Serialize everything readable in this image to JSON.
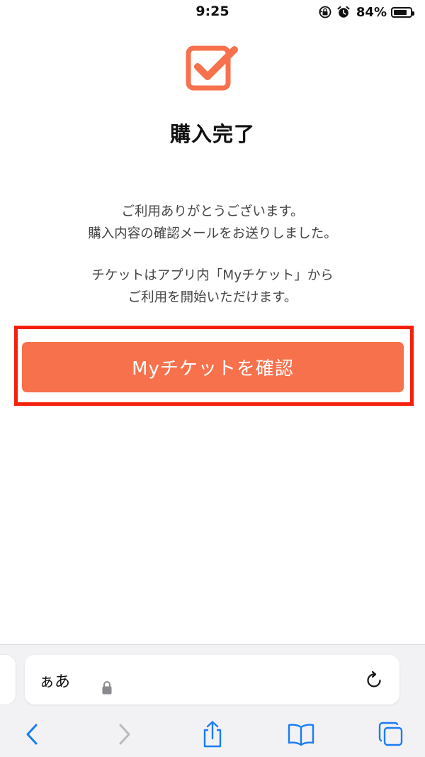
{
  "status_bar": {
    "time": "9:25",
    "battery_percent": "84%",
    "battery_level": 0.84,
    "icons": [
      "orientation-lock-icon",
      "alarm-icon",
      "battery-icon"
    ]
  },
  "page": {
    "title": "購入完了",
    "message_lines": [
      "ご利用ありがとうございます。",
      "購入内容の確認メールをお送りしました。",
      "チケットはアプリ内「Myチケット」から",
      "ご利用を開始いただけます。"
    ],
    "primary_button_label": "Myチケットを確認",
    "icon": "checkbox-checked-icon"
  },
  "browser": {
    "display_settings_label": "ぁあ",
    "toolbar_icons": [
      "back-icon",
      "forward-icon",
      "share-icon",
      "bookmarks-icon",
      "tabs-icon"
    ]
  },
  "colors": {
    "accent": "#f7714c",
    "highlight": "#f5200c",
    "ios_blue": "#1a7cf5"
  }
}
